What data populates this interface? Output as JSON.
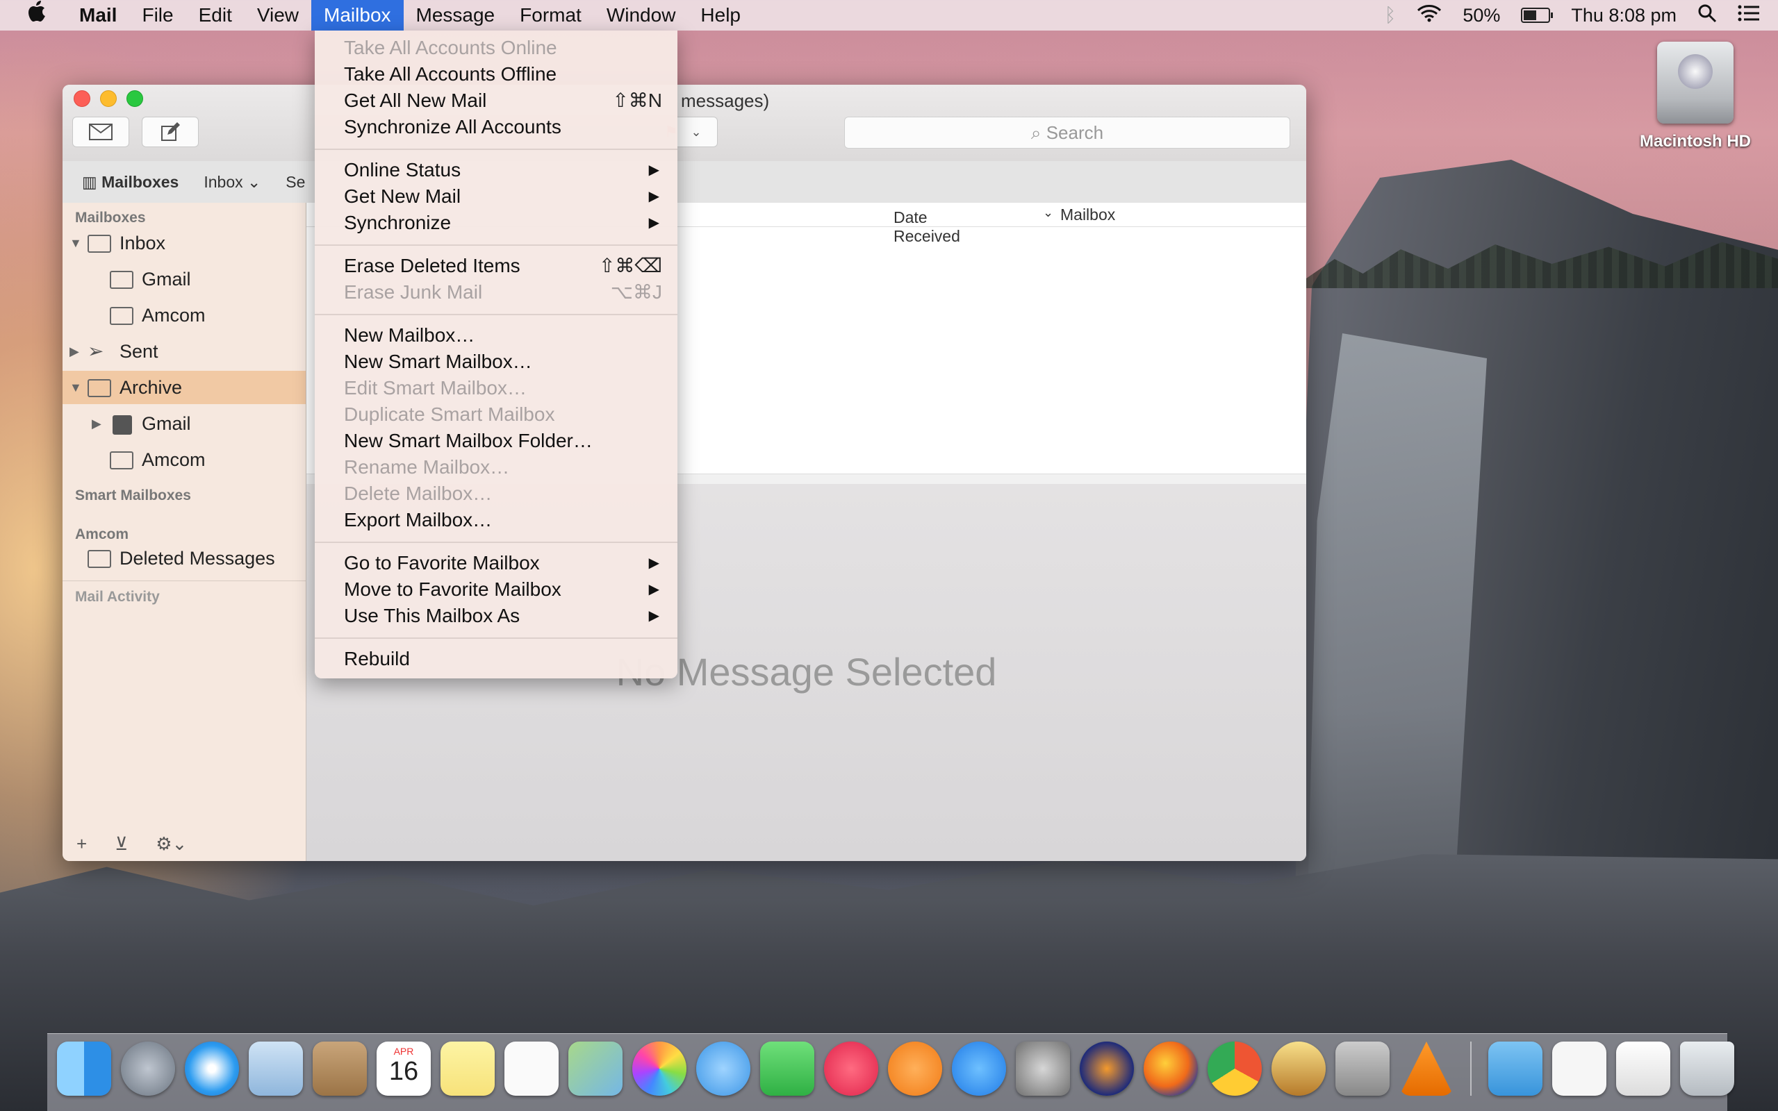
{
  "menubar": {
    "apple": "",
    "app_name": "Mail",
    "items": [
      "File",
      "Edit",
      "View",
      "Mailbox",
      "Message",
      "Format",
      "Window",
      "Help"
    ],
    "active": "Mailbox",
    "battery": "50%",
    "clock": "Thu 8:08 pm"
  },
  "desktop": {
    "drive_label": "Macintosh HD"
  },
  "window": {
    "title_fragment": "messages)",
    "search_placeholder": "Search",
    "favorites": {
      "mailboxes": "Mailboxes",
      "inbox": "Inbox",
      "sent_fragment": "Se"
    },
    "columns": {
      "date_received": "Date Received",
      "mailbox": "Mailbox"
    },
    "no_message": "No Message Selected"
  },
  "sidebar": {
    "header_mailboxes": "Mailboxes",
    "inbox": "Inbox",
    "inbox_children": [
      "Gmail",
      "Amcom"
    ],
    "sent": "Sent",
    "archive": "Archive",
    "archive_children": [
      "Gmail",
      "Amcom"
    ],
    "header_smart": "Smart Mailboxes",
    "header_amcom": "Amcom",
    "deleted": "Deleted Messages",
    "header_activity": "Mail Activity",
    "bottom": {
      "add": "+",
      "settings": "⚙⌄"
    }
  },
  "mailbox_menu": {
    "take_online": "Take All Accounts Online",
    "take_offline": "Take All Accounts Offline",
    "get_all_new": "Get All New Mail",
    "get_all_new_sc": "⇧⌘N",
    "sync_all": "Synchronize All Accounts",
    "online_status": "Online Status",
    "get_new_mail": "Get New Mail",
    "synchronize": "Synchronize",
    "erase_deleted": "Erase Deleted Items",
    "erase_deleted_sc": "⇧⌘⌫",
    "erase_junk": "Erase Junk Mail",
    "erase_junk_sc": "⌥⌘J",
    "new_mailbox": "New Mailbox…",
    "new_smart": "New Smart Mailbox…",
    "edit_smart": "Edit Smart Mailbox…",
    "dup_smart": "Duplicate Smart Mailbox",
    "new_smart_folder": "New Smart Mailbox Folder…",
    "rename": "Rename Mailbox…",
    "delete": "Delete Mailbox…",
    "export": "Export Mailbox…",
    "goto_fav": "Go to Favorite Mailbox",
    "move_fav": "Move to Favorite Mailbox",
    "use_as": "Use This Mailbox As",
    "rebuild": "Rebuild",
    "submenu_arrow": "▶"
  },
  "dock": {
    "apps": [
      "finder",
      "launchpad",
      "safari",
      "mail",
      "contacts",
      "calendar",
      "notes",
      "reminders",
      "maps",
      "photos",
      "messages",
      "facetime",
      "itunes",
      "ibooks",
      "app-store",
      "system-preferences",
      "audacity",
      "firefox",
      "chrome",
      "cocktail",
      "apple-script-editor",
      "vlc"
    ],
    "calendar_month": "APR",
    "calendar_day": "16"
  },
  "colors": {
    "accent": "#2f6fe0",
    "sidebar_selected": "#f1c9a4"
  }
}
